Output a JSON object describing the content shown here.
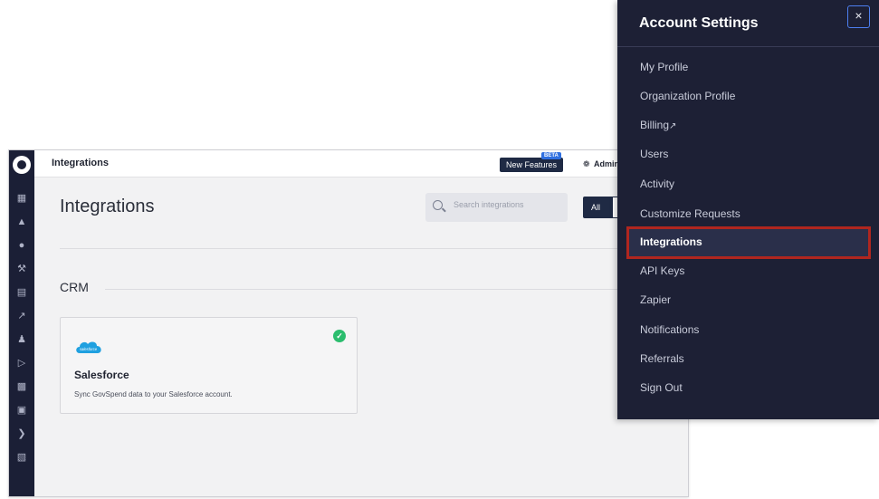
{
  "app": {
    "topbar": {
      "title": "Integrations",
      "new_features": "New Features",
      "beta_badge": "BETA",
      "admin": "Admin"
    },
    "page_title": "Integrations",
    "search": {
      "placeholder": "Search integrations"
    },
    "filters": {
      "all": "All"
    },
    "section": "CRM",
    "card": {
      "name": "Salesforce",
      "description": "Sync GovSpend data to your Salesforce account.",
      "logo_text": "salesforce",
      "connected": true
    },
    "rail_icons": [
      "dashboard-icon",
      "rocket-icon",
      "dollar-icon",
      "gavel-icon",
      "document-icon",
      "trend-icon",
      "people-icon",
      "play-icon",
      "calendar-icon",
      "bank-icon",
      "chevron-right-icon",
      "layers-icon"
    ]
  },
  "panel": {
    "title": "Account Settings",
    "close_label": "×",
    "items": [
      {
        "label": "My Profile"
      },
      {
        "label": "Organization Profile"
      },
      {
        "label": "Billing",
        "external": true
      },
      {
        "label": "Users"
      },
      {
        "label": "Activity"
      },
      {
        "label": "Customize Requests"
      },
      {
        "label": "Integrations",
        "active": true
      },
      {
        "label": "API Keys"
      },
      {
        "label": "Zapier"
      },
      {
        "label": "Notifications"
      },
      {
        "label": "Referrals"
      },
      {
        "label": "Sign Out"
      }
    ],
    "highlight_color": "#b0261f"
  }
}
